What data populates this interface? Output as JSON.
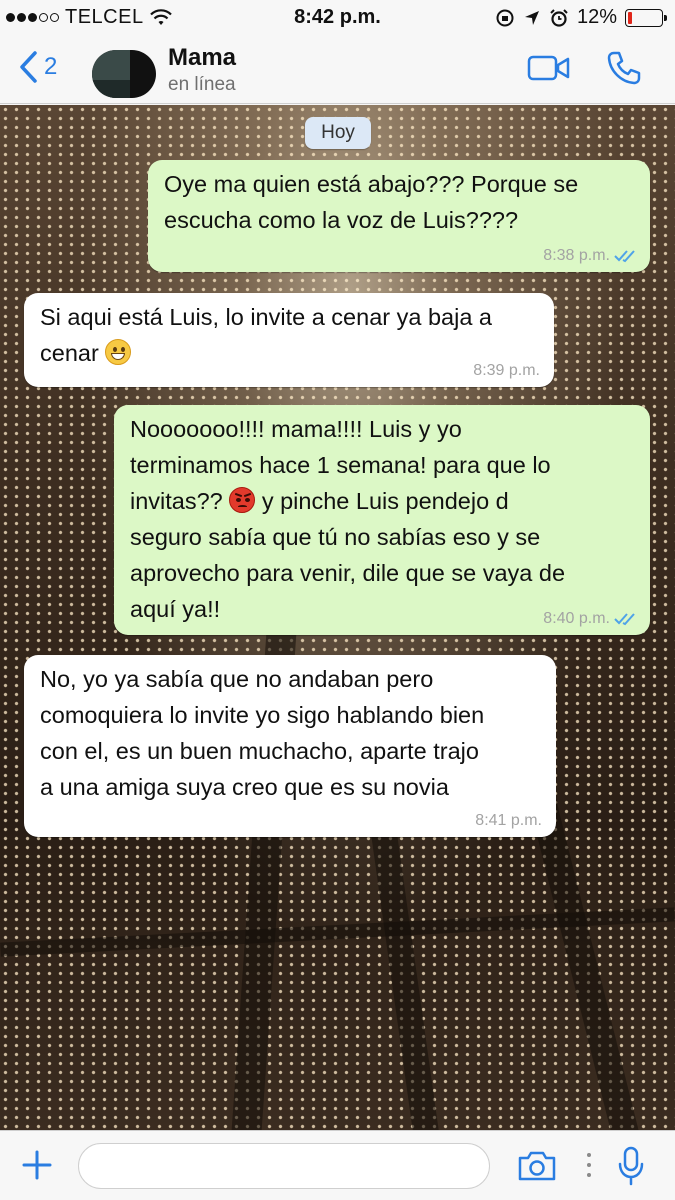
{
  "status_bar": {
    "carrier": "TELCEL",
    "time": "8:42 p.m.",
    "battery_percent": "12%",
    "battery_level": 0.12,
    "low_battery_color": "#e0261a"
  },
  "header": {
    "back_count": "2",
    "contact_name": "Mama",
    "contact_status": "en línea",
    "accent_color": "#2a7de1",
    "icons": [
      "back-chevron-icon",
      "video-call-icon",
      "phone-icon"
    ]
  },
  "chat": {
    "date_label": "Hoy",
    "outgoing_color": "#dcf8c6",
    "incoming_color": "#ffffff",
    "messages": [
      {
        "direction": "out",
        "lines": [
          "Oye ma quien está abajo??? Porque se",
          "escucha como la voz de Luis????"
        ],
        "time": "8:38 p.m.",
        "status_icon": "double-check-icon"
      },
      {
        "direction": "in",
        "lines": [
          "Si aqui está Luis, lo invite a cenar ya baja a",
          "cenar"
        ],
        "emoji": "grinning-face",
        "time": "8:39 p.m."
      },
      {
        "direction": "out",
        "lines": [
          "Nooooooo!!!!  mama!!!! Luis y yo",
          "terminamos hace 1 semana! para que lo",
          "invitas??",
          "y pinche Luis pendejo d",
          "seguro sabía que tú no sabías eso y se",
          "aprovecho para venir, dile que se vaya de",
          "aquí ya!!"
        ],
        "emoji": "angry-face",
        "time": "8:40 p.m.",
        "status_icon": "double-check-icon"
      },
      {
        "direction": "in",
        "lines": [
          "No, yo ya sabía que no andaban pero",
          "comoquiera lo invite yo sigo hablando bien",
          "con el, es un buen muchacho, aparte trajo",
          "a una amiga suya creo que es su novia"
        ],
        "time": "8:41 p.m."
      }
    ]
  },
  "input_bar": {
    "value": "",
    "placeholder": "",
    "icons": [
      "plus-icon",
      "camera-icon",
      "mic-icon"
    ]
  }
}
